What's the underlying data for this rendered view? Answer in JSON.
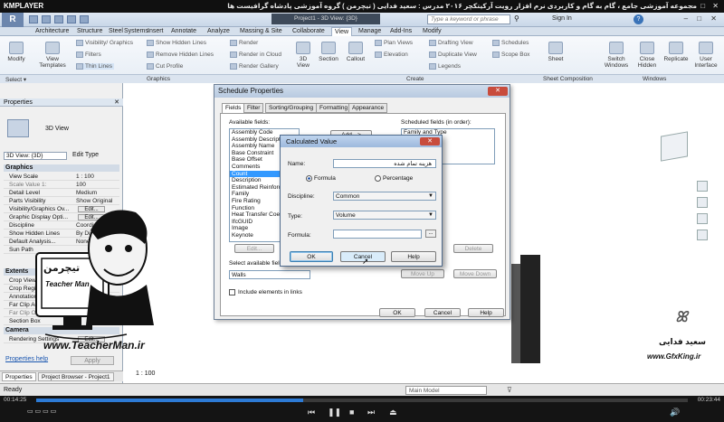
{
  "player": {
    "logo": "KMPLAYER",
    "title": "مجموعه آموزشی جامع ، گام به گام و کاربردی نرم افزار رویت آرکیتکچر ۲۰۱۶ مدرس : سعید فدایی ( تیچرمن ) گروه آموزشی پادشاه گرافیست ها",
    "time_elapsed": "00:14:25",
    "time_total": "00:23:44",
    "progress": 0.41
  },
  "app": {
    "document_title": "Project1 - 3D View: {3D}",
    "search_placeholder": "Type a keyword or phrase",
    "sign_in": "Sign In"
  },
  "ribbon_tabs": [
    "Architecture",
    "Structure",
    "Steel",
    "Systems",
    "Insert",
    "Annotate",
    "Analyze",
    "Massing & Site",
    "Collaborate",
    "View",
    "Manage",
    "Add-Ins",
    "Modify"
  ],
  "ribbon_active_tab": "View",
  "ribbon": {
    "modify": "Modify",
    "view_templates": "View Templates",
    "visibility_graphics": "Visibility/ Graphics",
    "filters": "Filters",
    "thin_lines": "Thin Lines",
    "show_hidden_lines": "Show Hidden Lines",
    "remove_hidden_lines": "Remove Hidden Lines",
    "cut_profile": "Cut Profile",
    "render": "Render",
    "render_cloud": "Render in Cloud",
    "render_gallery": "Render Gallery",
    "view_3d": "3D View",
    "section": "Section",
    "callout": "Callout",
    "plan_views": "Plan Views",
    "elevation": "Elevation",
    "drafting_view": "Drafting View",
    "duplicate_view": "Duplicate View",
    "legends": "Legends",
    "schedules": "Schedules",
    "scope_box": "Scope Box",
    "sheet": "Sheet",
    "switch_windows": "Switch Windows",
    "close_hidden": "Close Hidden",
    "replicate": "Replicate",
    "user_interface": "User Interface",
    "panels": [
      "Select",
      "Graphics",
      "Create",
      "Sheet Composition",
      "Windows"
    ]
  },
  "properties": {
    "title": "Properties",
    "type_name": "3D View",
    "filter": "3D View: {3D}",
    "edit_type": "Edit Type",
    "sections": [
      "Graphics",
      "Extents",
      "Camera"
    ],
    "graphics_rows": [
      {
        "k": "View Scale",
        "v": "1 : 100"
      },
      {
        "k": "Scale Value 1:",
        "v": "100"
      },
      {
        "k": "Detail Level",
        "v": "Medium"
      },
      {
        "k": "Parts Visibility",
        "v": "Show Original"
      },
      {
        "k": "Visibility/Graphics Ov...",
        "v": "Edit..."
      },
      {
        "k": "Graphic Display Opti...",
        "v": "Edit..."
      },
      {
        "k": "Discipline",
        "v": "Coordin..."
      },
      {
        "k": "Show Hidden Lines",
        "v": "By Discipl..."
      },
      {
        "k": "Default Analysis...",
        "v": "None"
      },
      {
        "k": "Sun Path",
        "v": ""
      }
    ],
    "extents_rows": [
      {
        "k": "Crop View",
        "v": ""
      },
      {
        "k": "Crop Region Visible",
        "v": ""
      },
      {
        "k": "Annotation Crop",
        "v": ""
      },
      {
        "k": "Far Clip Active",
        "v": ""
      },
      {
        "k": "Far Clip Offset",
        "v": ""
      },
      {
        "k": "Section Box",
        "v": ""
      }
    ],
    "camera_rows": [
      {
        "k": "Rendering Settings",
        "v": "Edit..."
      }
    ],
    "help_link": "Properties help",
    "apply": "Apply",
    "bottom_tabs": [
      "Properties",
      "Project Browser - Project1"
    ]
  },
  "canvas": {
    "scale": "1 : 100",
    "watermark_name": "سعید فدایی",
    "watermark_url": "www.GfxKing.ir",
    "teacher_url": "www.TeacherMan.ir",
    "teacher_logo": "تیچرمن",
    "teacher_caption": "Teacher Man"
  },
  "schedule_dialog": {
    "title": "Schedule Properties",
    "tabs": [
      "Fields",
      "Filter",
      "Sorting/Grouping",
      "Formatting",
      "Appearance"
    ],
    "available_label": "Available fields:",
    "available_fields": [
      "Assembly Code",
      "Assembly Description",
      "Assembly Name",
      "Base Constraint",
      "Base Offset",
      "Comments",
      "Count",
      "Description",
      "Estimated Reinforcement",
      "Family",
      "Fire Rating",
      "Function",
      "Heat Transfer Coeff.",
      "IfcGUID",
      "Image",
      "Keynote"
    ],
    "available_selected": "Count",
    "scheduled_label": "Scheduled fields (in order):",
    "scheduled_fields": [
      "Family and Type"
    ],
    "add_button": "Add -->",
    "edit_button": "Edit...",
    "delete_button": "Delete",
    "select_from_label": "Select available fields from:",
    "select_from_value": "Walls",
    "move_up": "Move Up",
    "move_down": "Move Down",
    "include_links": "Include elements in links",
    "ok": "OK",
    "cancel": "Cancel",
    "help": "Help"
  },
  "calc_dialog": {
    "title": "Calculated Value",
    "name_label": "Name:",
    "name_value": "هزینه تمام شده",
    "formula_radio": "Formula",
    "percentage_radio": "Percentage",
    "discipline_label": "Discipline:",
    "discipline_value": "Common",
    "type_label": "Type:",
    "type_value": "Volume",
    "formula_label": "Formula:",
    "formula_value": "",
    "browse": "...",
    "ok": "OK",
    "cancel": "Cancel",
    "help": "Help"
  },
  "status": {
    "ready": "Ready",
    "model": "Main Model"
  }
}
